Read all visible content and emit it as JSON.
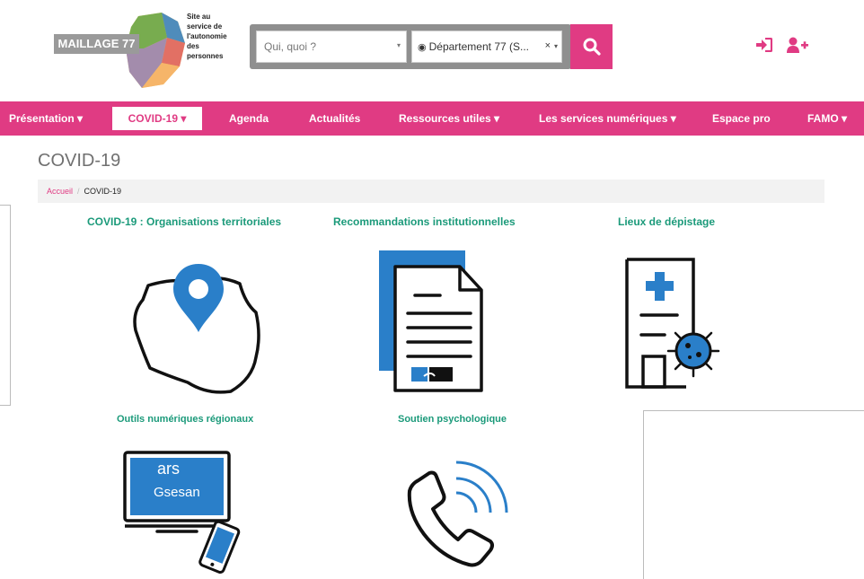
{
  "header": {
    "logo_text": "MAILLAGE 77",
    "tagline": [
      "Site au",
      "service de",
      "l'autonomie",
      "des",
      "personnes"
    ],
    "search": {
      "placeholder": "Qui, quoi ?",
      "caret": "▾"
    },
    "department": {
      "value": "Département 77 (S...",
      "globe": "◉",
      "clear": "×",
      "caret": "▾"
    },
    "icons": {
      "search": "search-icon",
      "login": "sign-in-icon",
      "register": "user-plus-icon"
    }
  },
  "nav": {
    "items": [
      {
        "label": "Présentation ▾"
      },
      {
        "label": "COVID-19 ▾"
      },
      {
        "label": "Agenda"
      },
      {
        "label": "Actualités"
      },
      {
        "label": "Ressources utiles ▾"
      },
      {
        "label": "Les services numériques ▾"
      },
      {
        "label": "Espace pro"
      },
      {
        "label": "FAMO ▾"
      }
    ]
  },
  "page": {
    "title": "COVID-19",
    "breadcrumb": {
      "home": "Accueil",
      "separator": "/",
      "current": "COVID-19"
    }
  },
  "tiles": [
    {
      "title": "COVID-19 : Organisations territoriales",
      "icon": "map-pin-region-icon"
    },
    {
      "title": "Recommandations institutionnelles",
      "icon": "document-icon"
    },
    {
      "title": "Lieux de dépistage",
      "icon": "hospital-virus-icon"
    },
    {
      "title": "Outils numériques régionaux",
      "icon": "computer-phone-icon",
      "screen_text_1": "ars",
      "screen_text_2": "Gsesan"
    },
    {
      "title": "Soutien psychologique",
      "icon": "phone-call-icon"
    }
  ],
  "colors": {
    "brand_pink": "#e03b83",
    "teal": "#1b9a7a",
    "blue": "#2a7fc9"
  }
}
